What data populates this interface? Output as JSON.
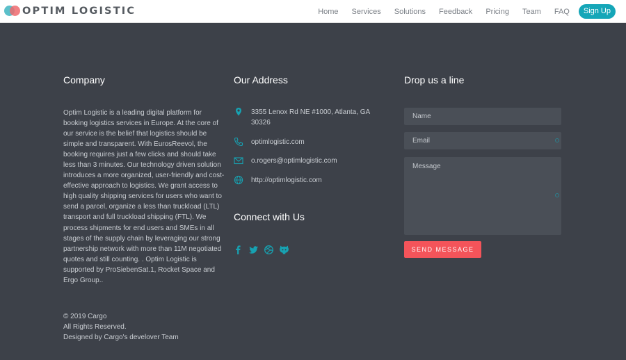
{
  "header": {
    "brand": "OPTIM LOGISTIC",
    "nav": [
      "Home",
      "Services",
      "Solutions",
      "Feedback",
      "Pricing",
      "Team",
      "FAQ"
    ],
    "signup_label": "Sign Up"
  },
  "company": {
    "title": "Company",
    "description": "Optim Logistic is a leading digital platform for booking logistics services in Europe. At the core of our service is the belief that logistics should be simple and transparent. With EurosReevol, the booking requires just a few clicks and should take less than 3 minutes. Our technology driven solution introduces a more organized, user-friendly and cost-effective approach to logistics. We grant access to high quality shipping services for users who want to send a parcel, organize a less than truckload (LTL) transport and full truckload shipping (FTL). We process shipments for end users and SMEs in all stages of the supply chain by leveraging our strong partnership network with more than 11M negotiated quotes and still counting. . Optim Logistic is supported by ProSiebenSat.1, Rocket Space and Ergo Group.."
  },
  "address": {
    "title": "Our Address",
    "street": "3355 Lenox Rd NE #1000, Atlanta, GA 30326",
    "website": "optimlogistic.com",
    "email": "o.rogers@optimlogistic.com",
    "url": "http://optimlogistic.com"
  },
  "connect": {
    "title": "Connect with Us",
    "icons": [
      "facebook-icon",
      "twitter-icon",
      "dribbble-icon",
      "github-icon"
    ]
  },
  "contact_form": {
    "title": "Drop us a line",
    "name_placeholder": "Name",
    "email_placeholder": "Email",
    "message_placeholder": "Message",
    "send_label": "SEND MESSAGE"
  },
  "footer": {
    "copyright": "© 2019 Cargo",
    "rights": "All Rights Reserved.",
    "credit": "Designed by Cargo's develover Team"
  },
  "colors": {
    "background": "#3d4149",
    "accent": "#17a2b2",
    "button": "#f4545a",
    "signup": "#15a6b8"
  }
}
